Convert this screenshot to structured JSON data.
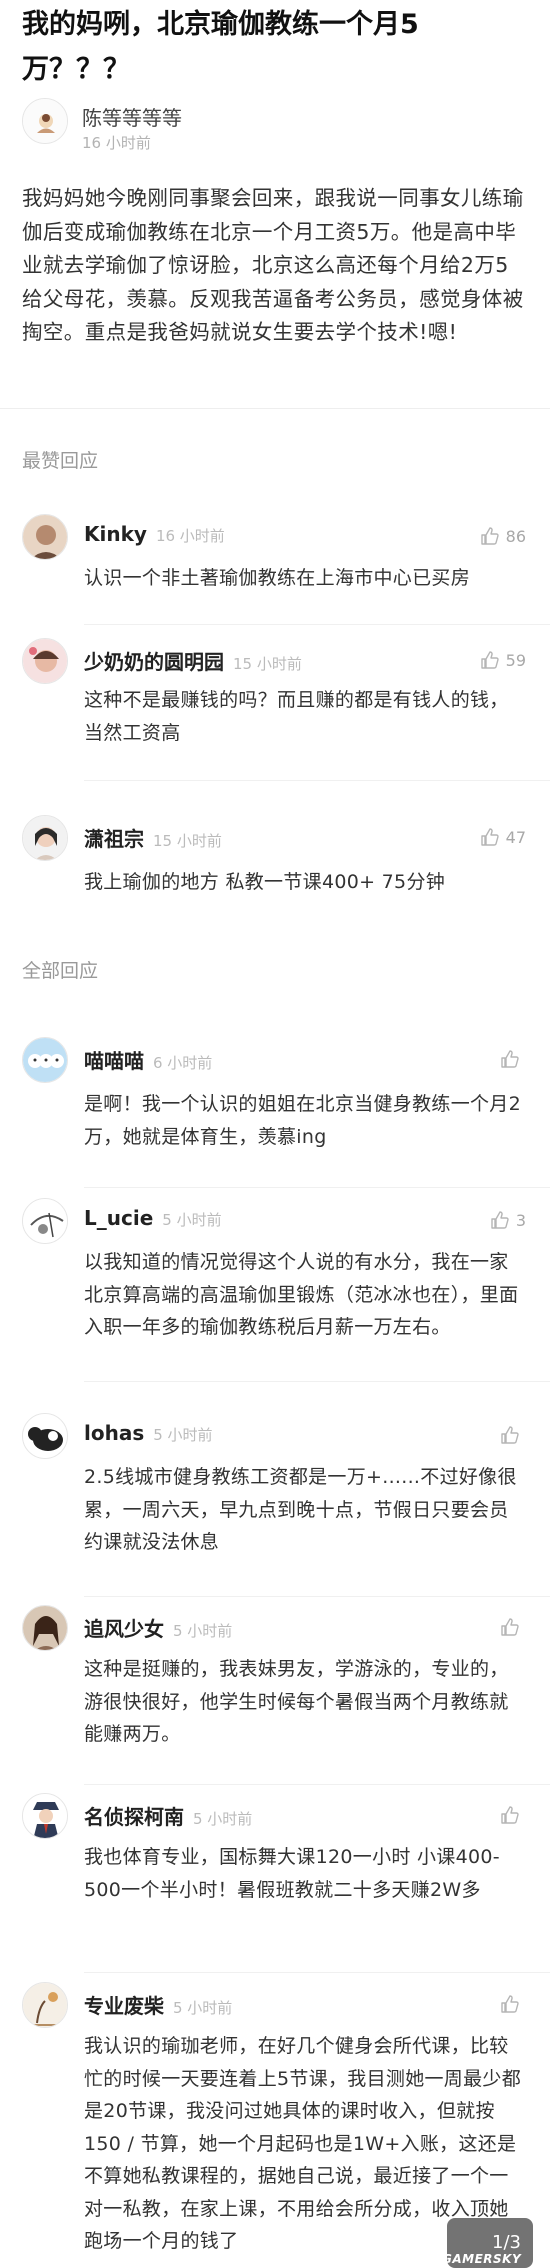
{
  "post": {
    "title": "我的妈咧，北京瑜伽教练一个月5万？？？",
    "author": "陈等等等等",
    "time": "16 小时前",
    "body": "我妈妈她今晚刚同事聚会回来，跟我说一同事女儿练瑜伽后变成瑜伽教练在北京一个月工资5万。他是高中毕业就去学瑜伽了惊讶脸，北京这么高还每个月给2万5给父母花，羡慕。反观我苦逼备考公务员，感觉身体被掏空。重点是我爸妈就说女生要去学个技术!嗯!"
  },
  "sections": {
    "top": "最赞回应",
    "all": "全部回应"
  },
  "top_comments": [
    {
      "name": "Kinky",
      "time": "16 小时前",
      "likes": "86",
      "text": "认识一个非土著瑜伽教练在上海市中心已买房"
    },
    {
      "name": "少奶奶的圆明园",
      "time": "15 小时前",
      "likes": "59",
      "text": "这种不是最赚钱的吗？而且赚的都是有钱人的钱，当然工资高"
    },
    {
      "name": "潇祖宗",
      "time": "15 小时前",
      "likes": "47",
      "text": "我上瑜伽的地方 私教一节课400+ 75分钟"
    }
  ],
  "all_comments": [
    {
      "name": "喵喵喵",
      "time": "6 小时前",
      "likes": "",
      "text": "是啊！我一个认识的姐姐在北京当健身教练一个月2万，她就是体育生，羡慕ing"
    },
    {
      "name": "L_ucie",
      "time": "5 小时前",
      "likes": "3",
      "text": "以我知道的情况觉得这个人说的有水分，我在一家北京算高端的高温瑜伽里锻炼（范冰冰也在），里面入职一年多的瑜伽教练税后月薪一万左右。"
    },
    {
      "name": "lohas",
      "time": "5 小时前",
      "likes": "",
      "text": "2.5线城市健身教练工资都是一万+......不过好像很累，一周六天，早九点到晚十点，节假日只要会员约课就没法休息"
    },
    {
      "name": "追风少女",
      "time": "5 小时前",
      "likes": "",
      "text": "这种是挺赚的，我表妹男友，学游泳的，专业的，游很快很好，他学生时候每个暑假当两个月教练就能赚两万。"
    },
    {
      "name": "名侦探柯南",
      "time": "5 小时前",
      "likes": "",
      "text": "我也体育专业，国标舞大课120一小时 小课400-500一个半小时！暑假班教就二十多天赚2W多"
    },
    {
      "name": "专业废柴",
      "time": "5 小时前",
      "likes": "",
      "text": "我认识的瑜珈老师，在好几个健身会所代课，比较忙的时候一天要连着上5节课，我目测她一周最少都是20节课，我没问过她具体的课时收入，但就按150 / 节算，她一个月起码也是1W+入账，这还是不算她私教课程的，据她自己说，最近接了一个一对一私教，在家上课，不用给会所分成，收入顶她跑场一个月的钱了"
    }
  ],
  "pager": "1/3",
  "watermark": "GAMERSKY"
}
